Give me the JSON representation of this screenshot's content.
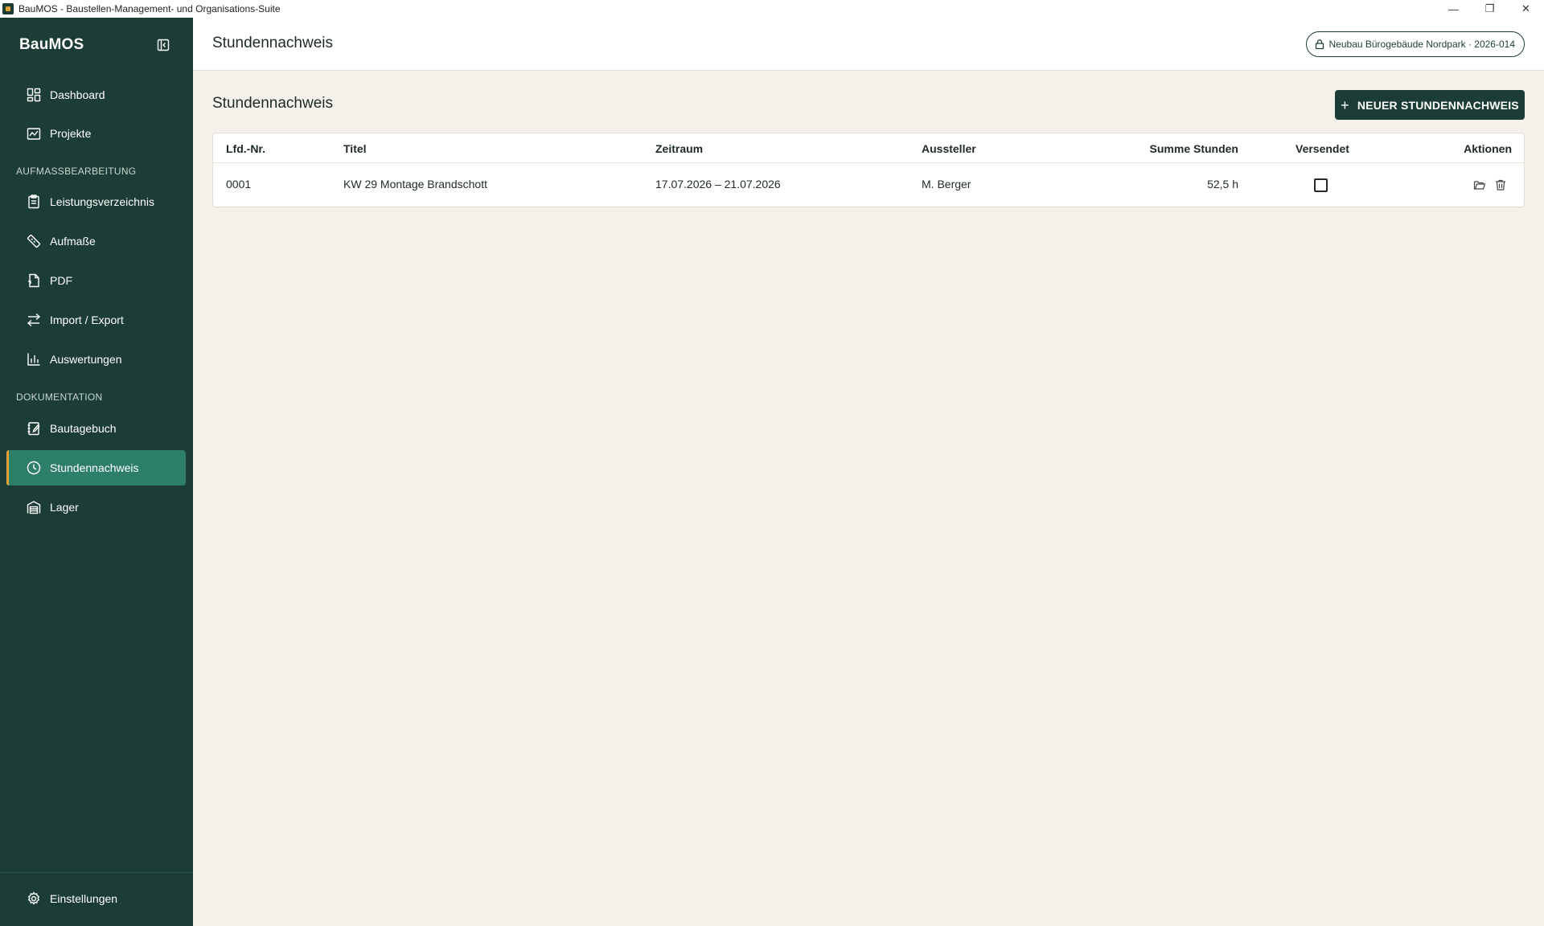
{
  "window": {
    "title": "BauMOS - Baustellen-Management- und Organisations-Suite",
    "controls": {
      "minimize": "—",
      "restore": "❐",
      "close": "✕"
    }
  },
  "sidebar": {
    "brand": "BauMOS",
    "collapse_icon": "sidebar-collapse-icon",
    "top_items": [
      {
        "label": "Dashboard",
        "icon": "dashboard-icon"
      },
      {
        "label": "Projekte",
        "icon": "projects-icon"
      }
    ],
    "section_measure": "AUFMASSBEARBEITUNG",
    "measure_items": [
      {
        "label": "Leistungsverzeichnis",
        "icon": "clipboard-icon"
      },
      {
        "label": "Aufmaße",
        "icon": "ruler-icon"
      },
      {
        "label": "PDF",
        "icon": "pdf-icon"
      },
      {
        "label": "Import / Export",
        "icon": "import-export-icon"
      },
      {
        "label": "Auswertungen",
        "icon": "chart-icon"
      }
    ],
    "section_docs": "DOKUMENTATION",
    "doc_items": [
      {
        "label": "Bautagebuch",
        "icon": "notebook-icon"
      },
      {
        "label": "Stundennachweis",
        "icon": "clock-icon",
        "active": true
      },
      {
        "label": "Lager",
        "icon": "warehouse-icon"
      }
    ],
    "settings": {
      "label": "Einstellungen",
      "icon": "gear-icon"
    }
  },
  "header": {
    "title": "Stundennachweis",
    "project": "Neubau Bürogebäude Nordpark · 2026-014"
  },
  "main": {
    "title": "Stundennachweis",
    "new_button": "NEUER STUNDENNACHWEIS",
    "columns": [
      "Lfd.-Nr.",
      "Titel",
      "Zeitraum",
      "Aussteller",
      "Summe Stunden",
      "Versendet",
      "Aktionen"
    ],
    "rows": [
      {
        "nr": "0001",
        "titel": "KW 29 Montage Brandschott",
        "zeitraum": "17.07.2026 – 21.07.2026",
        "aussteller": "M. Berger",
        "summe": "52,5 h",
        "versendet": false
      }
    ]
  },
  "colors": {
    "sidebar_bg": "#1c3d36",
    "active_bg": "#2e7f68",
    "accent": "#e0a13a",
    "page_bg": "#f4f1ea"
  }
}
